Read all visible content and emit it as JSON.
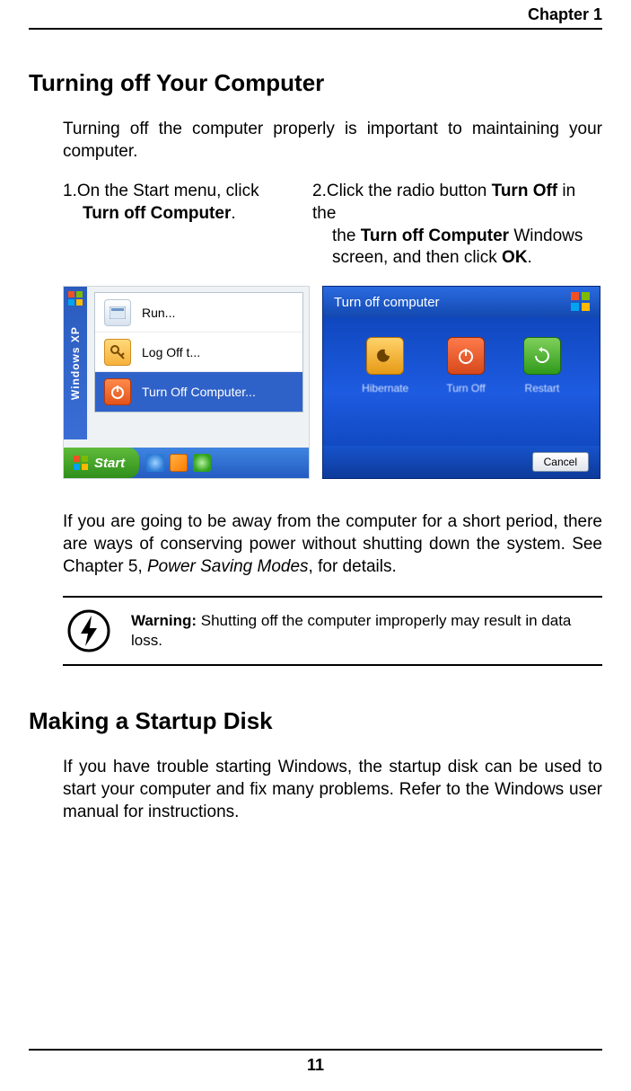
{
  "header": {
    "chapter": "Chapter 1"
  },
  "section1": {
    "title": "Turning off Your Computer",
    "intro": "Turning off the computer properly is important to maintaining your computer.",
    "step1_num": "1.",
    "step1_a": "On the Start menu, click ",
    "step1_b": "Turn off Computer",
    "step1_c": ".",
    "step2_num": "2.",
    "step2_a": "Click the radio button ",
    "step2_b": "Turn Off",
    "step2_c": " in the ",
    "step2_d": "Turn off Computer",
    "step2_e": " Windows screen, and then click ",
    "step2_f": "OK",
    "step2_g": ".",
    "after_a": "If you are going to be away from the computer for a short period, there are ways of conserving power without shutting down the system. See Chapter 5, ",
    "after_b": "Power Saving Modes",
    "after_c": ", for details.",
    "warn_label": "Warning:",
    "warn_text": " Shutting off the computer improperly may result in data loss."
  },
  "fig1": {
    "tab": "Windows XP",
    "run": "Run...",
    "logoff": "Log Off t...",
    "turnoff": "Turn Off Computer...",
    "start": "Start"
  },
  "fig2": {
    "title": "Turn off computer",
    "hibernate": "Hibernate",
    "turnoff": "Turn Off",
    "restart": "Restart",
    "cancel": "Cancel"
  },
  "section2": {
    "title": "Making a Startup Disk",
    "body": "If you have trouble starting Windows, the startup disk can be used to start your computer and fix many problems. Refer to the Windows user manual for instructions."
  },
  "footer": {
    "page": "11"
  }
}
